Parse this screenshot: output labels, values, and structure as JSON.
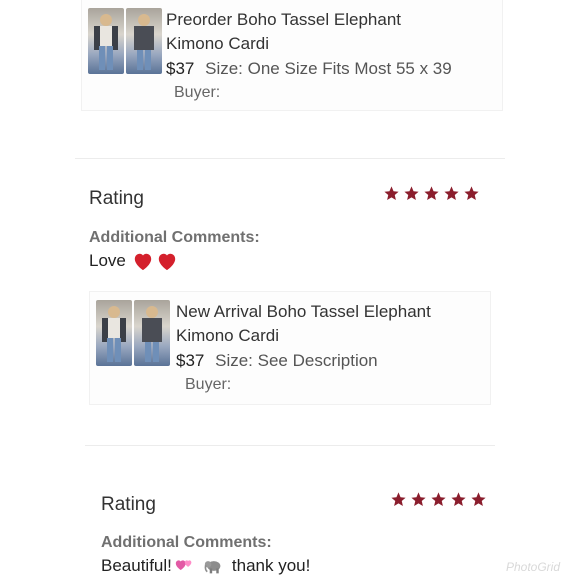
{
  "order1": {
    "title_line1": "Preorder Boho Tassel Elephant",
    "title_line2": "Kimono Cardi",
    "price": "$37",
    "size": "Size: One Size Fits Most 55 x 39",
    "buyer": "Buyer:"
  },
  "review1": {
    "rating_label": "Rating",
    "stars": 5,
    "comments_label": "Additional Comments:",
    "comment_text": "Love"
  },
  "order2": {
    "title_line1": "New Arrival Boho Tassel Elephant",
    "title_line2": "Kimono Cardi",
    "price": "$37",
    "size": "Size: See Description",
    "buyer": "Buyer:"
  },
  "review2": {
    "rating_label": "Rating",
    "stars": 5,
    "comments_label": "Additional Comments:",
    "comment_text": "Beautiful!",
    "comment_tail": "thank you!"
  },
  "colors": {
    "star": "#8b1e2d",
    "heart": "#d4202c"
  },
  "watermark": "PhotoGrid"
}
